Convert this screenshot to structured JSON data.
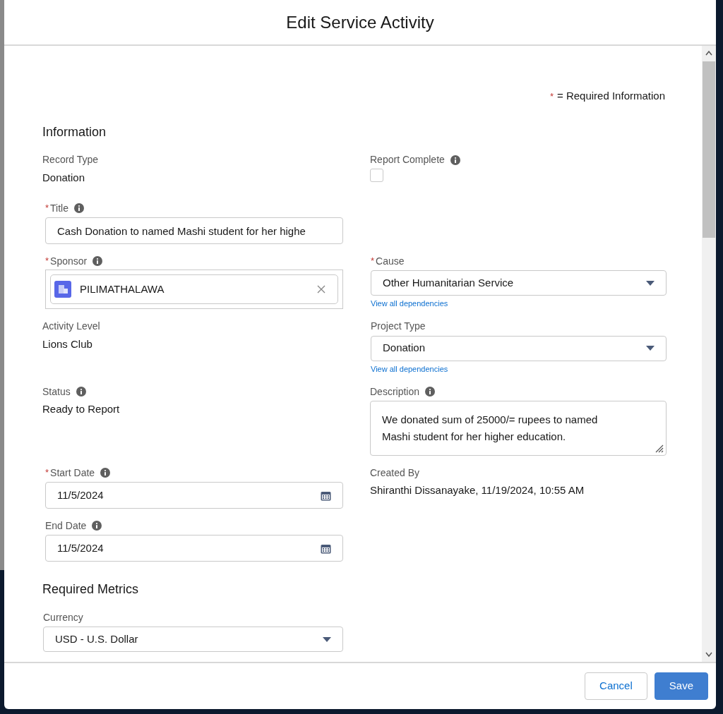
{
  "modal": {
    "title": "Edit Service Activity"
  },
  "required_note": {
    "mark": "*",
    "text": "= Required Information"
  },
  "sections": [
    {
      "heading": "Information",
      "rows": [
        [
          {
            "kind": "readonly",
            "label": "Record Type",
            "required": false,
            "info": false,
            "value": "Donation"
          },
          {
            "kind": "checkbox",
            "label": "Report Complete",
            "required": false,
            "info": true,
            "checked": false
          }
        ],
        [
          {
            "kind": "text",
            "label": "Title",
            "required": true,
            "info": true,
            "value": "Cash Donation to named Mashi student for her highe"
          },
          {
            "kind": "empty"
          }
        ],
        [
          {
            "kind": "lookup",
            "label": "Sponsor",
            "required": true,
            "info": true,
            "value": "PILIMATHALAWA"
          },
          {
            "kind": "select",
            "label": "Cause",
            "required": true,
            "info": false,
            "value": "Other Humanitarian Service",
            "link": "View all dependencies"
          }
        ],
        [
          {
            "kind": "readonly",
            "label": "Activity Level",
            "required": false,
            "info": false,
            "value": "Lions Club"
          },
          {
            "kind": "select",
            "label": "Project Type",
            "required": false,
            "info": false,
            "value": "Donation",
            "link": "View all dependencies"
          }
        ],
        [
          {
            "kind": "readonly",
            "label": "Status",
            "required": false,
            "info": true,
            "value": "Ready to Report"
          },
          {
            "kind": "textarea",
            "label": "Description",
            "required": false,
            "info": true,
            "value": "We donated sum of 25000/= rupees to named Mashi student for her higher education."
          }
        ],
        [
          {
            "kind": "date",
            "label": "Start Date",
            "required": true,
            "info": true,
            "value": "11/5/2024"
          },
          {
            "kind": "readonly",
            "label": "Created By",
            "required": false,
            "info": false,
            "value": "Shiranthi Dissanayake, 11/19/2024, 10:55 AM"
          }
        ],
        [
          {
            "kind": "date",
            "label": "End Date",
            "required": false,
            "info": true,
            "value": "11/5/2024"
          },
          {
            "kind": "empty"
          }
        ]
      ]
    },
    {
      "heading": "Required Metrics",
      "rows": [
        [
          {
            "kind": "select",
            "label": "Currency",
            "required": false,
            "info": false,
            "value": "USD - U.S. Dollar"
          },
          {
            "kind": "empty"
          }
        ]
      ]
    }
  ],
  "buttons": [
    {
      "label": "Cancel",
      "kind": "neutral"
    },
    {
      "label": "Save",
      "kind": "brand"
    }
  ]
}
